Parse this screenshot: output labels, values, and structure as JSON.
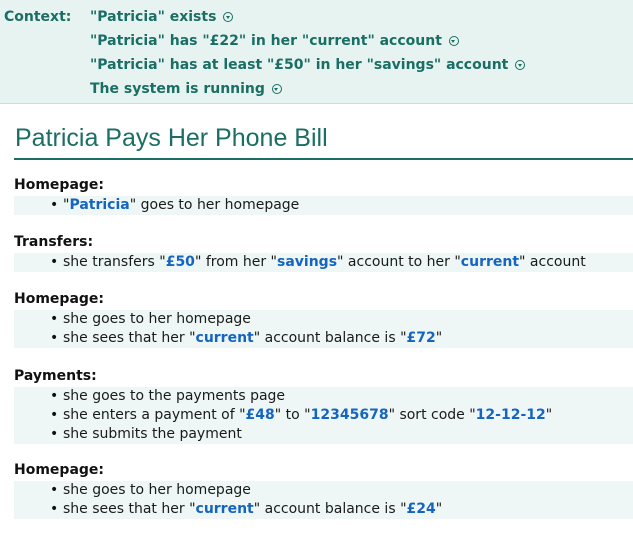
{
  "context": {
    "label": "Context:",
    "items": [
      "\"Patricia\" exists",
      "\"Patricia\" has \"£22\" in her \"current\" account",
      "\"Patricia\" has at least \"£50\" in her \"savings\" account",
      "The system is running"
    ]
  },
  "scenario": {
    "title": "Patricia Pays Her Phone Bill",
    "sections": [
      {
        "heading": "Homepage:",
        "steps": [
          [
            {
              "t": "\""
            },
            {
              "t": "Patricia",
              "v": true
            },
            {
              "t": "\" goes to her homepage"
            }
          ]
        ]
      },
      {
        "heading": "Transfers:",
        "steps": [
          [
            {
              "t": "she transfers \""
            },
            {
              "t": "£50",
              "v": true
            },
            {
              "t": "\" from her \""
            },
            {
              "t": "savings",
              "v": true
            },
            {
              "t": "\" account to her \""
            },
            {
              "t": "current",
              "v": true
            },
            {
              "t": "\" account"
            }
          ]
        ]
      },
      {
        "heading": "Homepage:",
        "steps": [
          [
            {
              "t": "she goes to her homepage"
            }
          ],
          [
            {
              "t": "she sees that her \""
            },
            {
              "t": "current",
              "v": true
            },
            {
              "t": "\" account balance is \""
            },
            {
              "t": "£72",
              "v": true
            },
            {
              "t": "\""
            }
          ]
        ]
      },
      {
        "heading": "Payments:",
        "steps": [
          [
            {
              "t": "she goes to the payments page"
            }
          ],
          [
            {
              "t": "she enters a payment of \""
            },
            {
              "t": "£48",
              "v": true
            },
            {
              "t": "\" to \""
            },
            {
              "t": "12345678",
              "v": true
            },
            {
              "t": "\" sort code \""
            },
            {
              "t": "12-12-12",
              "v": true
            },
            {
              "t": "\""
            }
          ],
          [
            {
              "t": "she submits the payment"
            }
          ]
        ]
      },
      {
        "heading": "Homepage:",
        "steps": [
          [
            {
              "t": "she goes to her homepage"
            }
          ],
          [
            {
              "t": "she sees that her \""
            },
            {
              "t": "current",
              "v": true
            },
            {
              "t": "\" account balance is \""
            },
            {
              "t": "£24",
              "v": true
            },
            {
              "t": "\""
            }
          ]
        ]
      }
    ]
  }
}
